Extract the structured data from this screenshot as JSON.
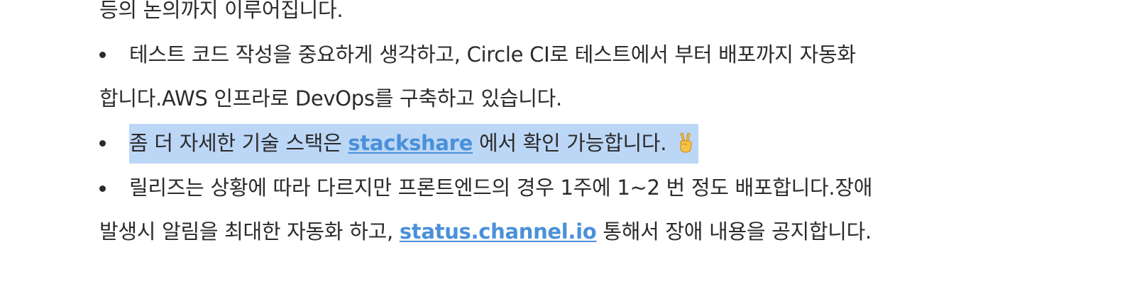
{
  "paragraph_tail": {
    "text": "등의 논의까지 이루어집니다."
  },
  "list": {
    "item1": {
      "line1": "테스트 코드 작성을 중요하게 생각하고, Circle CI로 테스트에서 부터 배포까지 자동화",
      "line2": "합니다.AWS 인프라로 DevOps를 구축하고 있습니다."
    },
    "item2": {
      "before": "좀 더 자세한 기술 스택은 ",
      "link": "stackshare",
      "after": " 에서 확인 가능합니다. ",
      "emoji_icon": "victory-hand-icon"
    },
    "item3": {
      "line1": "릴리즈는 상황에 따라 다르지만 프론트엔드의 경우 1주에 1~2 번 정도 배포합니다.장애",
      "line2_before": "발생시 알림을 최대한 자동화 하고, ",
      "line2_link": "status.channel.io",
      "line2_after": " 통해서 장애 내용을 공지합니다."
    }
  },
  "colors": {
    "text": "#2b2b2b",
    "link": "#4a90d9",
    "selection": "#bcd6f6"
  }
}
